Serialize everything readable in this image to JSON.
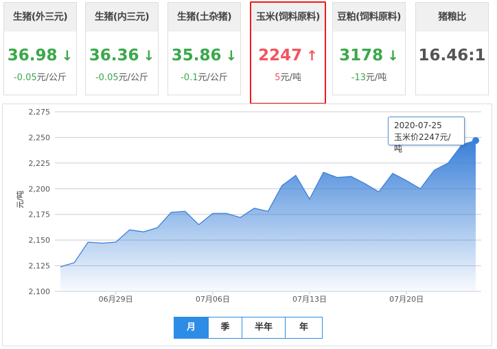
{
  "cards": [
    {
      "title": "生猪(外三元)",
      "value": "36.98",
      "arrow": "↓",
      "change": "-0.05",
      "unit": "元/公斤",
      "trend": "down"
    },
    {
      "title": "生猪(内三元)",
      "value": "36.36",
      "arrow": "↓",
      "change": "-0.05",
      "unit": "元/公斤",
      "trend": "down"
    },
    {
      "title": "生猪(土杂猪)",
      "value": "35.86",
      "arrow": "↓",
      "change": "-0.1",
      "unit": "元/公斤",
      "trend": "down"
    },
    {
      "title": "玉米(饲料原料)",
      "value": "2247",
      "arrow": "↑",
      "change": "5",
      "unit": "元/吨",
      "trend": "up"
    },
    {
      "title": "豆粕(饲料原料)",
      "value": "3178",
      "arrow": "↓",
      "change": "-13",
      "unit": "元/吨",
      "trend": "down"
    },
    {
      "title": "猪粮比",
      "value": "16.46:1"
    }
  ],
  "tooltip": {
    "date": "2020-07-25",
    "text": "玉米价2247元/吨"
  },
  "periods": [
    "月",
    "季",
    "半年",
    "年"
  ],
  "chart_data": {
    "type": "area",
    "ylabel": "元/吨",
    "ylim": [
      2100,
      2275
    ],
    "yticks": [
      "2,100",
      "2,125",
      "2,150",
      "2,175",
      "2,200",
      "2,225",
      "2,250",
      "2,275"
    ],
    "xtick_labels": [
      {
        "index": 4,
        "label": "06月29日"
      },
      {
        "index": 11,
        "label": "07月06日"
      },
      {
        "index": 18,
        "label": "07月13日"
      },
      {
        "index": 25,
        "label": "07月20日"
      }
    ],
    "start_date": "2020-06-25",
    "values": [
      2124,
      2128,
      2148,
      2147,
      2148,
      2160,
      2158,
      2162,
      2177,
      2178,
      2165,
      2176,
      2176,
      2172,
      2181,
      2178,
      2203,
      2213,
      2190,
      2216,
      2211,
      2212,
      2205,
      2197,
      2215,
      2208,
      2200,
      2218,
      2225,
      2243,
      2247
    ],
    "color": "#3a80d8"
  }
}
